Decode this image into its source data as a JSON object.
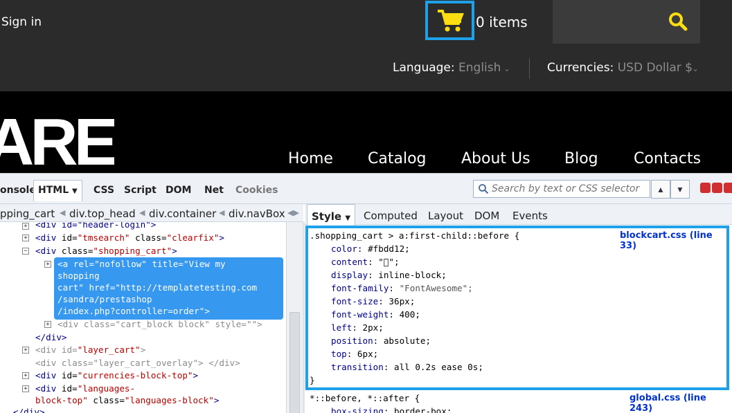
{
  "site": {
    "sign_in": "Sign in",
    "cart_items": "0 items",
    "language_label": "Language:",
    "language_value": " English",
    "currency_label": "Currencies:",
    "currency_value": " USD Dollar $",
    "logo_text": "ARE",
    "nav": [
      "Home",
      "Catalog",
      "About Us",
      "Blog",
      "Contacts"
    ],
    "accent_color": "#fbdd12",
    "highlight_color": "#1ea1e8"
  },
  "firebug": {
    "tabs": [
      "onsole",
      "HTML",
      "CSS",
      "Script",
      "DOM",
      "Net",
      "Cookies"
    ],
    "search_placeholder": "Search by text or CSS selector",
    "breadcrumbs": [
      "pping_cart",
      "div.top_head",
      "div.container",
      "div.navBox"
    ],
    "side_tabs": [
      "Style",
      "Computed",
      "Layout",
      "DOM",
      "Events"
    ],
    "html_lines": {
      "l0": "<div id=\"header-login\">",
      "l1_tag": "<div",
      "l1_attr": " id=",
      "l1_val": "\"tmsearch\"",
      "l1_attr2": " class=",
      "l1_val2": "\"clearfix\"",
      "l1_end": ">",
      "l2_tag": "<div",
      "l2_attr": " class=",
      "l2_val": "\"shopping_cart\"",
      "l2_end": ">",
      "sel1": "<a rel=\"nofollow\" title=\"View my",
      "sel2": "shopping",
      "sel3": "cart\" href=\"http://templatetesting.com",
      "sel4": "/sandra/prestashop",
      "sel5": "/index.php?controller=order\">",
      "l4": "<div class=\"cart_block block\" style=\"\">",
      "l5": "</div>",
      "l6_tag": "<div",
      "l6_attr": " id=",
      "l6_val": "\"layer_cart\"",
      "l6_end": ">",
      "l7": "<div class=\"layer_cart_overlay\"> </div>",
      "l8_tag": "<div",
      "l8_attr": " id=",
      "l8_val": "\"currencies-block-top\"",
      "l8_end": ">",
      "l9_tag": "<div",
      "l9_attr": " id=",
      "l9_val": "\"languages-",
      "l10_val": "block-top\"",
      "l10_attr": " class=",
      "l10_val2": "\"languages-block\"",
      "l10_end": ">",
      "l11": "</div>"
    },
    "css_rule": {
      "selector": ".shopping_cart > a:first-child::before {",
      "source": "blockcart.css (line 33)",
      "props": [
        {
          "name": "color",
          "value": "#fbdd12;"
        },
        {
          "name": "content",
          "value": "\"\";"
        },
        {
          "name": "display",
          "value": "inline-block;"
        },
        {
          "name": "font-family",
          "value": "\"FontAwesome\";"
        },
        {
          "name": "font-size",
          "value": "36px;"
        },
        {
          "name": "font-weight",
          "value": "400;"
        },
        {
          "name": "left",
          "value": "2px;"
        },
        {
          "name": "position",
          "value": "absolute;"
        },
        {
          "name": "top",
          "value": "6px;"
        },
        {
          "name": "transition",
          "value": "all 0.2s ease 0s;"
        }
      ],
      "close": "}"
    },
    "css_rule2": {
      "selector": "*::before, *::after {",
      "source": "global.css (line 243)",
      "prop_name": "box-sizing",
      "prop_value": "border-box;"
    }
  }
}
